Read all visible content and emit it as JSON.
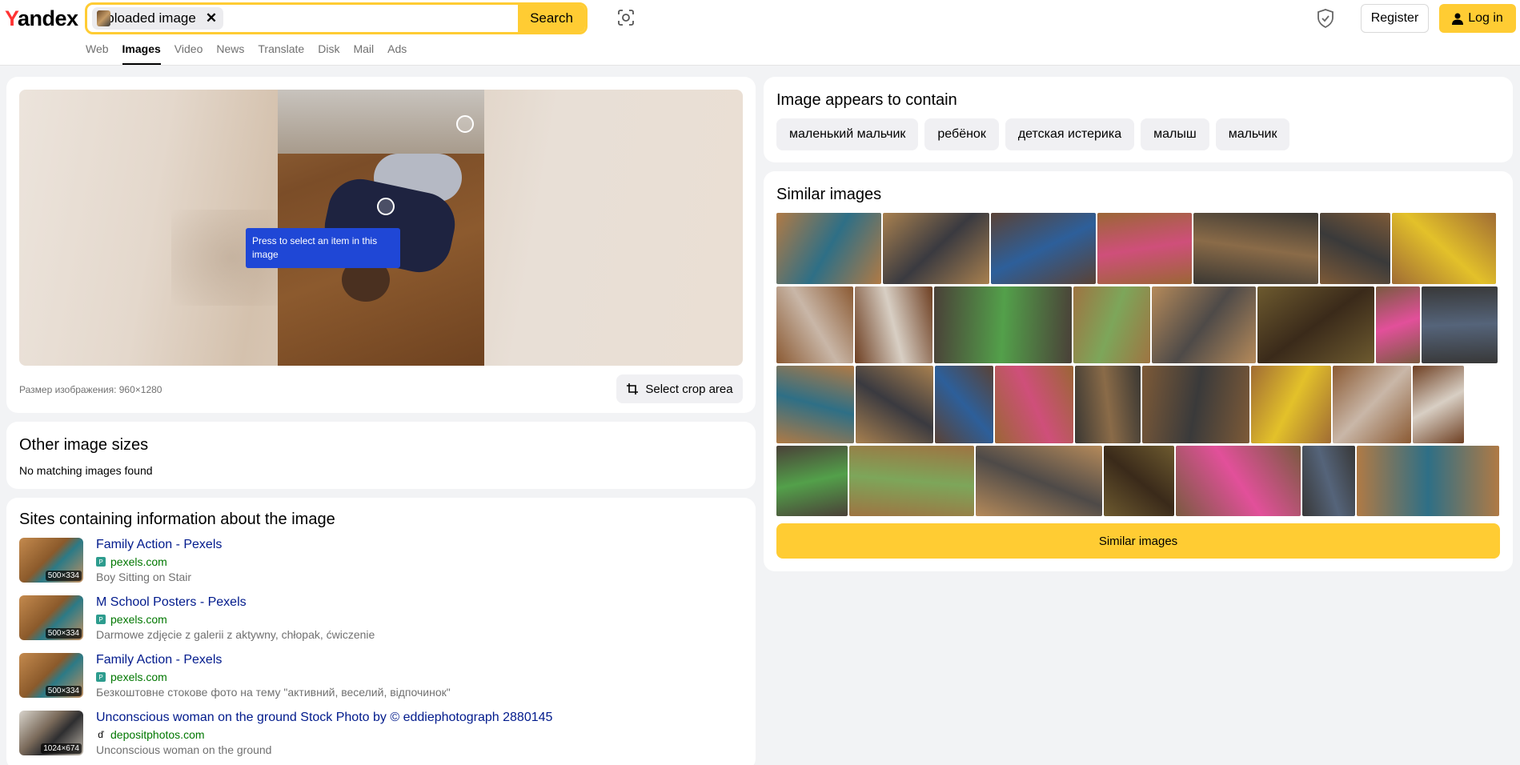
{
  "header": {
    "logo_first": "Y",
    "logo_rest": "andex",
    "search_chip": "Uploaded image",
    "search_clear": "✕",
    "search_button": "Search",
    "register": "Register",
    "login": "Log in",
    "nav": [
      "Web",
      "Images",
      "Video",
      "News",
      "Translate",
      "Disk",
      "Mail",
      "Ads"
    ],
    "nav_active": "Images"
  },
  "preview": {
    "tooltip": "Press to select an item in this image",
    "size_text": "Размер изображения: 960×1280",
    "crop_button": "Select crop area"
  },
  "sizes": {
    "title": "Other image sizes",
    "message": "No matching images found"
  },
  "sites": {
    "title": "Sites containing information about the image",
    "items": [
      {
        "title": "Family Action - Pexels",
        "domain": "pexels.com",
        "desc": "Boy Sitting on Stair",
        "dims": "500×334"
      },
      {
        "title": "M School Posters - Pexels",
        "domain": "pexels.com",
        "desc": "Darmowe zdjęcie z galerii z aktywny, chłopak, ćwiczenie",
        "dims": "500×334"
      },
      {
        "title": "Family Action - Pexels",
        "domain": "pexels.com",
        "desc": "Безкоштовне стокове фото на тему \"активний, веселий, відпочинок\"",
        "dims": "500×334"
      },
      {
        "title": "Unconscious woman on the ground Stock Photo by © eddiephotograph 2880145",
        "domain": "depositphotos.com",
        "desc": "Unconscious woman on the ground",
        "dims": "1024×674"
      }
    ]
  },
  "contains": {
    "title": "Image appears to contain",
    "tags": [
      "маленький мальчик",
      "ребёнок",
      "детская истерика",
      "малыш",
      "мальчик"
    ]
  },
  "similar": {
    "title": "Similar images",
    "button": "Similar images"
  },
  "colors": {
    "accent": "#ffcc33",
    "link": "#001a8c",
    "domain": "#007700",
    "tooltip_bg": "#1f47d6"
  }
}
